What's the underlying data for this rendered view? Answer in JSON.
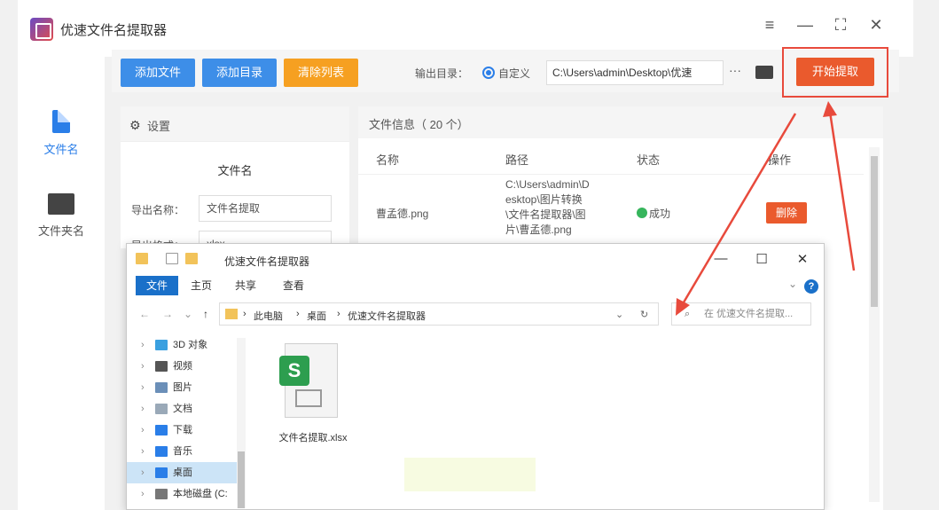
{
  "app": {
    "title": "优速文件名提取器",
    "window_controls": [
      "≡",
      "—",
      "⛶",
      "✕"
    ]
  },
  "leftnav": {
    "items": [
      {
        "label": "文件名",
        "icon": "file-icon",
        "active": true
      },
      {
        "label": "文件夹名",
        "icon": "folder-icon",
        "active": false
      }
    ]
  },
  "toolbar": {
    "add_file": "添加文件",
    "add_dir": "添加目录",
    "clear_list": "清除列表",
    "output_label": "输出目录：",
    "radio_label": "自定义",
    "output_path": "C:\\Users\\admin\\Desktop\\优速",
    "more": "···",
    "start": "开始提取"
  },
  "settings": {
    "title": "设置",
    "subtitle": "文件名",
    "export_name_label": "导出名称：",
    "export_name_value": "文件名提取",
    "export_format_label": "导出格式：",
    "export_format_value": "xlsx"
  },
  "fileinfo": {
    "title": "文件信息（ 20 个）",
    "columns": [
      "名称",
      "路径",
      "状态",
      "操作"
    ],
    "rows": [
      {
        "name": "曹孟德.png",
        "path_lines": [
          "C:\\Users\\admin\\D",
          "esktop\\图片转换",
          "\\文件名提取器\\图",
          "片\\曹孟德.png"
        ],
        "status": "成功",
        "action": "删除"
      }
    ]
  },
  "explorer": {
    "title": "优速文件名提取器",
    "ribbon_tabs": [
      "文件",
      "主页",
      "共享",
      "查看"
    ],
    "breadcrumb": [
      "此电脑",
      "桌面",
      "优速文件名提取器"
    ],
    "search_placeholder": "在 优速文件名提取...",
    "sidebar": [
      {
        "label": "3D 对象",
        "color": "#3aa0e0"
      },
      {
        "label": "视频",
        "color": "#555555"
      },
      {
        "label": "图片",
        "color": "#6b8fb8"
      },
      {
        "label": "文档",
        "color": "#9aa9b8"
      },
      {
        "label": "下载",
        "color": "#2a7ee8"
      },
      {
        "label": "音乐",
        "color": "#2a7ee8"
      },
      {
        "label": "桌面",
        "color": "#2a7ee8",
        "selected": true
      },
      {
        "label": "本地磁盘 (C:",
        "color": "#777777"
      }
    ],
    "file": {
      "name": "文件名提取.xlsx",
      "badge": "S"
    }
  },
  "colors": {
    "accent": "#2a7ee8",
    "orange": "#f6a021",
    "start": "#ea5a2d",
    "annotation": "#e84a3c"
  }
}
